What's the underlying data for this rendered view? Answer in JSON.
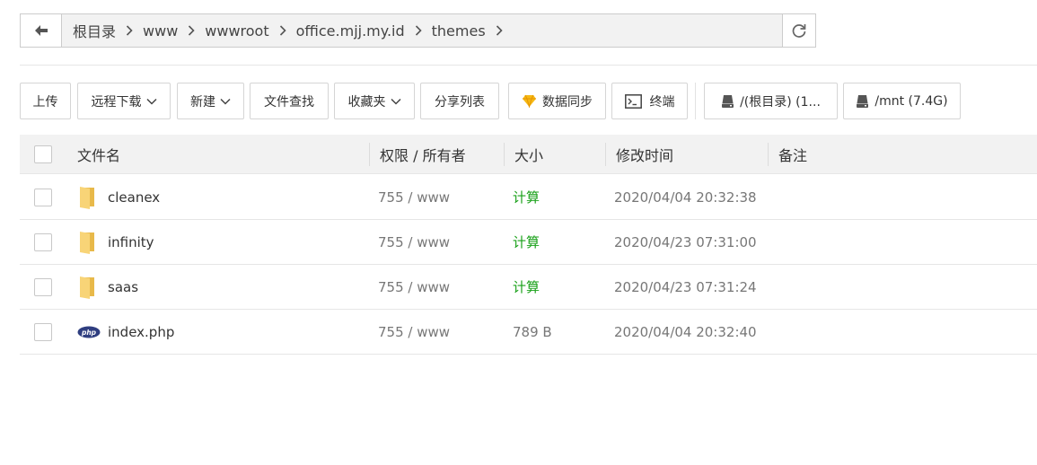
{
  "pathbar": {
    "back_icon": "arrow-left-icon",
    "crumbs": [
      "根目录",
      "www",
      "wwwroot",
      "office.mjj.my.id",
      "themes"
    ],
    "refresh_icon": "refresh-icon"
  },
  "toolbar": {
    "upload": "上传",
    "remote_download": "远程下载",
    "new": "新建",
    "file_search": "文件查找",
    "favorites": "收藏夹",
    "share_list": "分享列表",
    "sync": "数据同步",
    "terminal": "终端",
    "disk_root": "/(根目录) (1...",
    "disk_mnt": "/mnt (7.4G)"
  },
  "table": {
    "headers": {
      "name": "文件名",
      "perm": "权限 / 所有者",
      "size": "大小",
      "mtime": "修改时间",
      "remark": "备注"
    },
    "rows": [
      {
        "name": "cleanex",
        "type": "folder",
        "perm": "755 / www",
        "size": "计算",
        "mtime": "2020/04/04 20:32:38"
      },
      {
        "name": "infinity",
        "type": "folder",
        "perm": "755 / www",
        "size": "计算",
        "mtime": "2020/04/23 07:31:00"
      },
      {
        "name": "saas",
        "type": "folder",
        "perm": "755 / www",
        "size": "计算",
        "mtime": "2020/04/23 07:31:24"
      },
      {
        "name": "index.php",
        "type": "php",
        "perm": "755 / www",
        "size": "789 B",
        "mtime": "2020/04/04 20:32:40"
      }
    ]
  },
  "colors": {
    "calc_link": "#1aa11a",
    "folder": "#f8d477",
    "php_badge": "#2f3e80"
  }
}
